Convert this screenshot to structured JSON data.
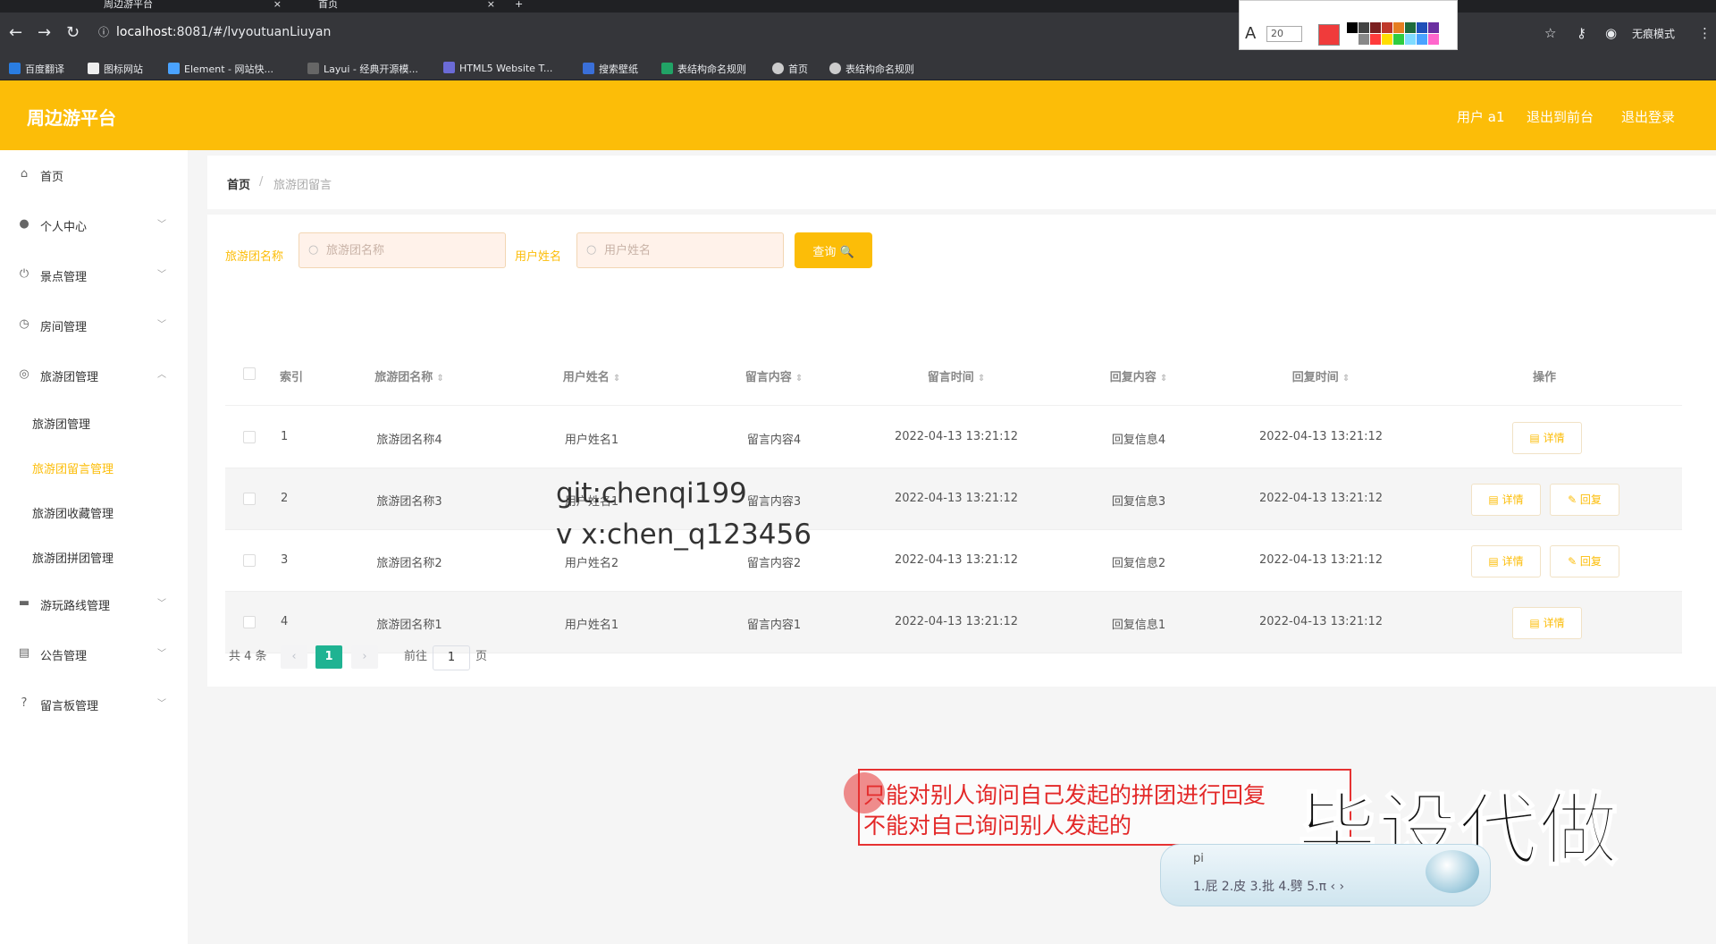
{
  "browser": {
    "tabs": [
      {
        "title": "周边游平台",
        "close": "×"
      },
      {
        "title": "首页",
        "close": "×"
      }
    ],
    "new_tab": "+",
    "url_host": "localhost",
    "url_rest": ":8081/#/lvyoutuanLiuyan",
    "bookmarks": [
      "百度翻译",
      "图标网站",
      "Element - 网站快...",
      "Layui - 经典开源模...",
      "HTML5 Website T...",
      "搜索壁纸",
      "表结构命名规则",
      "首页",
      "表结构命名规则"
    ],
    "incognito_label": "无痕模式",
    "font_size": "20",
    "accent_color": "#f03b3b",
    "palette": [
      "#000000",
      "#444444",
      "#7b2020",
      "#c0392b",
      "#e67e22",
      "#1e6b3c",
      "#1f4fb8",
      "#6b2fa0",
      "#ffffff",
      "#888888",
      "#ff3b3b",
      "#ffdd00",
      "#2ecc40",
      "#7fdbff",
      "#4aa3ff",
      "#ff66cc"
    ]
  },
  "header": {
    "brand": "周边游平台",
    "user": "用户 a1",
    "back_front": "退出到前台",
    "logout": "退出登录",
    "color": "#fcbd08"
  },
  "sidebar": {
    "items": [
      {
        "label": "首页",
        "icon": "home-icon",
        "glyph": "⌂"
      },
      {
        "label": "个人中心",
        "icon": "user-icon",
        "glyph": "👤"
      },
      {
        "label": "景点管理",
        "icon": "power-icon",
        "glyph": "⏻"
      },
      {
        "label": "房间管理",
        "icon": "clock-icon",
        "glyph": "◷"
      },
      {
        "label": "旅游团管理",
        "icon": "compass-icon",
        "glyph": "◎"
      },
      {
        "label": "游玩路线管理",
        "icon": "briefcase-icon",
        "glyph": "▬"
      },
      {
        "label": "公告管理",
        "icon": "clipboard-icon",
        "glyph": "▤"
      },
      {
        "label": "留言板管理",
        "icon": "help-icon",
        "glyph": "?"
      }
    ],
    "sub_items": [
      "旅游团管理",
      "旅游团留言管理",
      "旅游团收藏管理",
      "旅游团拼团管理"
    ],
    "active_sub": "旅游团留言管理"
  },
  "breadcrumb": {
    "home": "首页",
    "sep": "/",
    "current": "旅游团留言"
  },
  "filters": {
    "group_label": "旅游团名称",
    "group_placeholder": "旅游团名称",
    "user_label": "用户姓名",
    "user_placeholder": "用户姓名",
    "query_button": "查询 🔍"
  },
  "table": {
    "columns": [
      "索引",
      "旅游团名称",
      "用户姓名",
      "留言内容",
      "留言时间",
      "回复内容",
      "回复时间",
      "操作"
    ],
    "rows": [
      {
        "index": "1",
        "group": "旅游团名称4",
        "user": "用户姓名1",
        "message": "留言内容4",
        "msg_time": "2022-04-13 13:21:12",
        "reply": "回复信息4",
        "reply_time": "2022-04-13 13:21:12"
      },
      {
        "index": "2",
        "group": "旅游团名称3",
        "user": "用户姓名1",
        "message": "留言内容3",
        "msg_time": "2022-04-13 13:21:12",
        "reply": "回复信息3",
        "reply_time": "2022-04-13 13:21:12"
      },
      {
        "index": "3",
        "group": "旅游团名称2",
        "user": "用户姓名2",
        "message": "留言内容2",
        "msg_time": "2022-04-13 13:21:12",
        "reply": "回复信息2",
        "reply_time": "2022-04-13 13:21:12"
      },
      {
        "index": "4",
        "group": "旅游团名称1",
        "user": "用户姓名1",
        "message": "留言内容1",
        "msg_time": "2022-04-13 13:21:12",
        "reply": "回复信息1",
        "reply_time": "2022-04-13 13:21:12"
      }
    ],
    "detail_label": "▤ 详情",
    "reply_label": "✎ 回复"
  },
  "pagination": {
    "total": "共 4 条",
    "prev": "‹",
    "current": "1",
    "next": "›",
    "goto": "前往",
    "goto_value": "1",
    "page_unit": "页"
  },
  "overlay": {
    "watermark1": "git:chenqi199",
    "watermark2": "v x:chen_q123456",
    "note_line1": "只能对别人询问自己发起的拼团进行回复",
    "note_line2": "不能对自己询问别人发起的",
    "big_text": "毕设代做",
    "ime_input": "pi",
    "ime_candidates": "1.屁   2.皮   3.批   4.劈   5.π   ‹ ›"
  }
}
